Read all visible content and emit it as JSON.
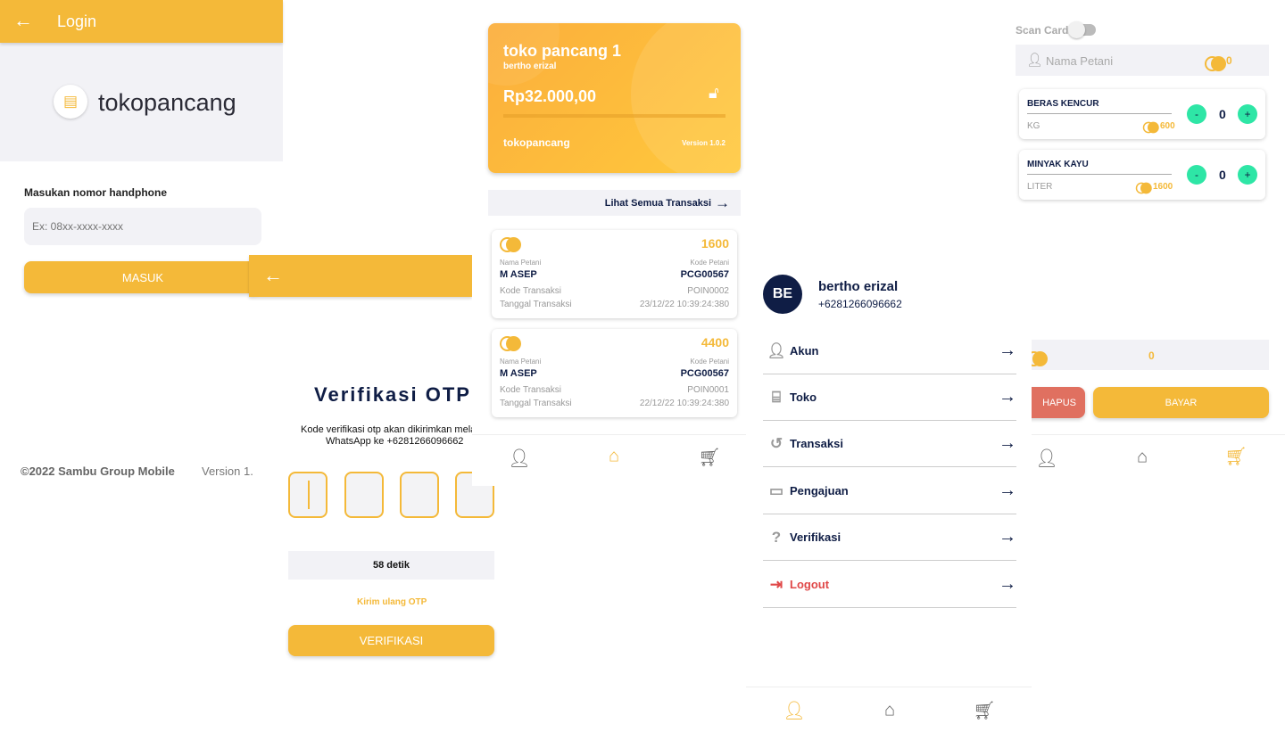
{
  "login": {
    "title": "Login",
    "logo_text": "tokopancang",
    "phone_label": "Masukan nomor handphone",
    "phone_placeholder": "Ex: 08xx-xxxx-xxxx",
    "submit": "MASUK",
    "copyright": "©2022 Sambu Group Mobile",
    "version": "Version 1."
  },
  "otp": {
    "title": "Verifikasi OTP",
    "desc_line1": "Kode verifikasi otp akan dikirimkan mela",
    "desc_line2": "WhatsApp ke +6281266096662",
    "timer": "58 detik",
    "resend": "Kirim ulang OTP",
    "submit": "VERIFIKASI"
  },
  "home": {
    "store_name": "toko pancang 1",
    "owner": "bertho erizal",
    "balance": "Rp32.000,00",
    "brand": "tokopancang",
    "version": "Version 1.0.2",
    "see_all": "Lihat Semua Transaksi",
    "transactions": [
      {
        "points": "1600",
        "farmer_label": "Nama Petani",
        "farmer": "M ASEP",
        "code_label": "Kode Petani",
        "code": "PCG00567",
        "tx_label": "Kode Transaksi",
        "tx": "POIN0002",
        "date_label": "Tanggal Transaksi",
        "date": "23/12/22 10:39:24:380"
      },
      {
        "points": "4400",
        "farmer_label": "Nama Petani",
        "farmer": "M ASEP",
        "code_label": "Kode Petani",
        "code": "PCG00567",
        "tx_label": "Kode Transaksi",
        "tx": "POIN0001",
        "date_label": "Tanggal Transaksi",
        "date": "22/12/22 10:39:24:380"
      }
    ]
  },
  "profile": {
    "initials": "BE",
    "name": "bertho erizal",
    "phone": "+6281266096662",
    "menu": [
      {
        "label": "Akun"
      },
      {
        "label": "Toko"
      },
      {
        "label": "Transaksi"
      },
      {
        "label": "Pengajuan"
      },
      {
        "label": "Verifikasi"
      },
      {
        "label": "Logout"
      }
    ]
  },
  "cart": {
    "scan_label": "Scan Card",
    "scan_on": false,
    "farmer_placeholder": "Nama Petani",
    "farmer_points": "0",
    "items": [
      {
        "name": "BERAS KENCUR",
        "unit": "KG",
        "price": "600",
        "qty": "0"
      },
      {
        "name": "MINYAK KAYU",
        "unit": "LITER",
        "price": "1600",
        "qty": "0"
      }
    ],
    "total": "0",
    "delete": "HAPUS",
    "pay": "BAYAR",
    "minus": "-",
    "plus": "+"
  },
  "colors": {
    "primary": "#F4B939",
    "navy": "#0f1d45",
    "danger": "#E07060",
    "accent": "#2EE6A6"
  }
}
